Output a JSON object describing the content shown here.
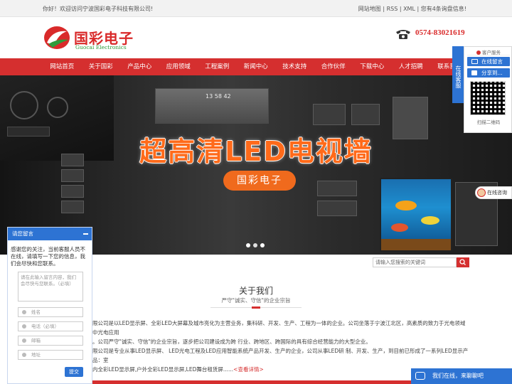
{
  "topbar": {
    "welcome": "你好！欢迎访问宁波国彩电子科技有限公司!",
    "links": "网站地图 | RSS | XML | 您有4条询盘信息!"
  },
  "header": {
    "logo_cn": "国彩电子",
    "logo_en": "Guocai Electronics",
    "phone": "0574-83021619"
  },
  "nav": {
    "items": [
      "网站首页",
      "关于国彩",
      "产品中心",
      "应用领域",
      "工程案例",
      "新闻中心",
      "技术支持",
      "合作伙伴",
      "下载中心",
      "人才招聘",
      "联系我们"
    ]
  },
  "banner": {
    "headline": "超高清LED电视墙",
    "brand": "国彩电子",
    "screen_time": "13 58 42"
  },
  "search": {
    "placeholder": "请输入您搜索的关键词"
  },
  "about": {
    "title": "关于我们",
    "subtitle": "严守\"诚实、守信\"的企业宗旨",
    "text1": "限公司是以LED显示屏、全彩LED大屏幕及城市亮化为主营业务，集科研、开发、生产、工程为一体的企业。公司坐落于宁波江北区，高素质的致力于光电领域中光电应用",
    "text2": "。公司严守\"诚实、守信\"的企业宗旨，逐步把公司建设成为跨 行业、跨地区、跨国际的具有综合经营能力的大型企业。",
    "text3": "限公司是专业从事LED显示屏、 LED光电工程及LED应用智能系统产品开发、生产的企业，公司从事LED研 制、开发、生产，到目前已形成了一系列LED显示产品：室",
    "text4": "内全彩LED显示屏,户外全彩LED显示屏,LED舞台租赁屏......",
    "more": "<查看详情>"
  },
  "float_service": {
    "strip": "在线客服",
    "title": "客户服务",
    "leave_msg": "在线留言",
    "share": "分享到...",
    "qr_label": "扫描二维码"
  },
  "consult": {
    "label": "在线咨询"
  },
  "message_box": {
    "title": "请您留言",
    "intro": "感谢您的关注，当前客服人员不在线，请填写一下您的信息，我们会尽快和您联系。",
    "content_placeholder": "请在此输入留言内容，我们会尽快与您联系。（必填）",
    "name_placeholder": "姓名",
    "phone_placeholder": "电话（必填）",
    "email_placeholder": "邮箱",
    "address_placeholder": "地址",
    "submit": "提交"
  },
  "chat": {
    "label": "我们在线，来聊聊吧"
  },
  "colors": {
    "brand_red": "#d52f2f",
    "accent_blue": "#2d73d3",
    "headline_orange": "#ff6a1a"
  }
}
